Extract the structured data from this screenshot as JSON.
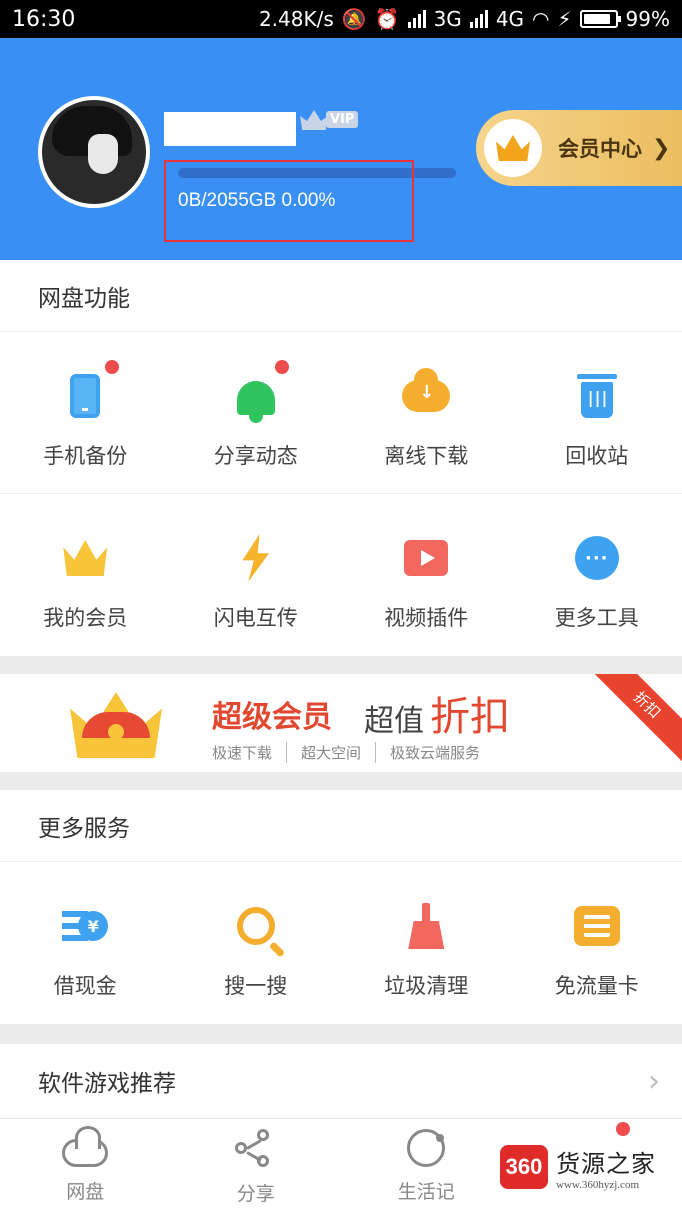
{
  "status_bar": {
    "time": "16:30",
    "speed": "2.48K/s",
    "net1": "3G",
    "net2": "4G",
    "battery": "99%"
  },
  "header": {
    "quota_text": "0B/2055GB 0.00%",
    "quota_fraction": 0.0,
    "vip_label": "VIP",
    "member_center": "会员中心"
  },
  "features": {
    "title": "网盘功能",
    "items": [
      {
        "label": "手机备份",
        "icon": "phone-icon",
        "dot": true
      },
      {
        "label": "分享动态",
        "icon": "bell-icon",
        "dot": true
      },
      {
        "label": "离线下载",
        "icon": "cloud-download-icon",
        "dot": false
      },
      {
        "label": "回收站",
        "icon": "trash-icon",
        "dot": false
      },
      {
        "label": "我的会员",
        "icon": "crown-icon",
        "dot": false
      },
      {
        "label": "闪电互传",
        "icon": "lightning-icon",
        "dot": false
      },
      {
        "label": "视频插件",
        "icon": "video-play-icon",
        "dot": false
      },
      {
        "label": "更多工具",
        "icon": "more-icon",
        "dot": false
      }
    ]
  },
  "banner": {
    "title": "超级会员",
    "title2": "超值",
    "title3": "折扣",
    "ribbon": "折扣",
    "subtitles": [
      "极速下载",
      "超大空间",
      "极致云端服务"
    ]
  },
  "services": {
    "title": "更多服务",
    "items": [
      {
        "label": "借现金",
        "icon": "cash-icon"
      },
      {
        "label": "搜一搜",
        "icon": "search-icon"
      },
      {
        "label": "垃圾清理",
        "icon": "broom-icon"
      },
      {
        "label": "免流量卡",
        "icon": "sim-card-icon"
      }
    ]
  },
  "recommend": {
    "title": "软件游戏推荐"
  },
  "tabbar": {
    "items": [
      {
        "label": "网盘",
        "icon": "cloud-icon"
      },
      {
        "label": "分享",
        "icon": "share-icon"
      },
      {
        "label": "生活记",
        "icon": "life-icon"
      },
      {
        "label": "",
        "icon": "profile-icon"
      }
    ]
  },
  "watermark": {
    "logo": "360",
    "name": "货源之家",
    "url": "www.360hyzj.com"
  },
  "colors": {
    "header_blue": "#3a8ff5",
    "accent_red": "#e2472f",
    "gold": "#eabc5d"
  }
}
